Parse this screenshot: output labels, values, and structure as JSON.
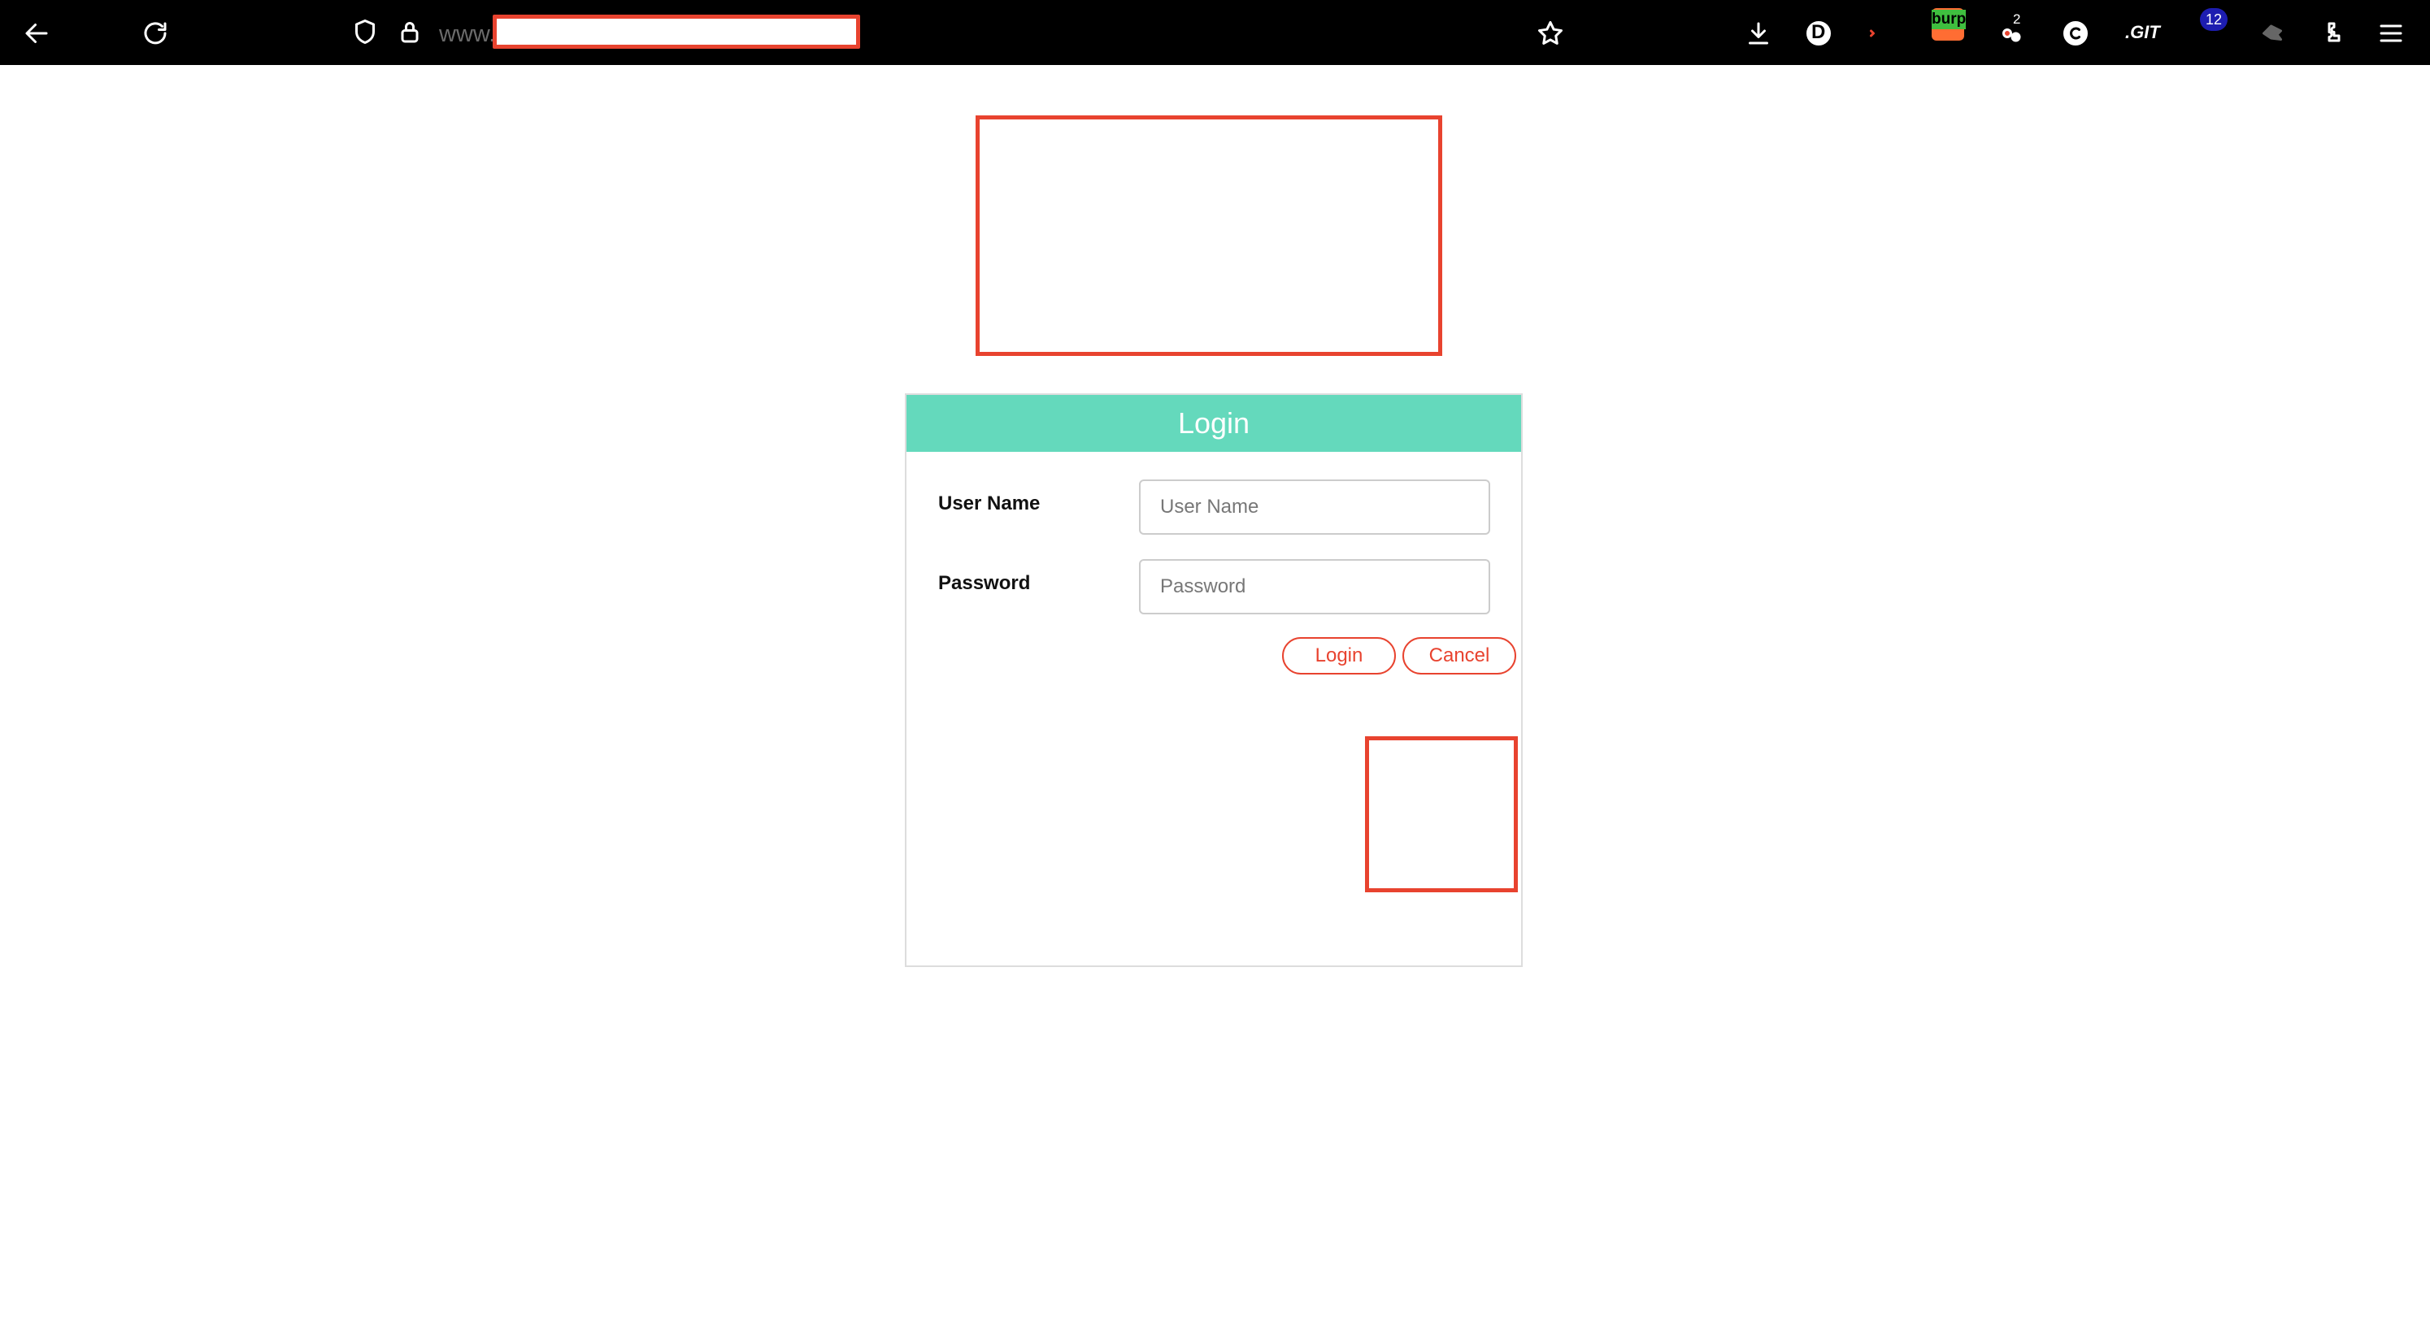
{
  "browser": {
    "url_prefix": "www.",
    "extensions": {
      "burp_label": "burp",
      "counter_badge": "2",
      "tab_count_badge": "12",
      "d_icon_letter": "D",
      "git_icon_text": ".GIT"
    },
    "icons": [
      "back-arrow-icon",
      "reload-icon",
      "shield-icon",
      "lock-icon",
      "star-icon",
      "download-icon",
      "puzzle-icon",
      "menu-icon"
    ]
  },
  "login": {
    "header": "Login",
    "username_label": "User Name",
    "username_placeholder": "User Name",
    "username_value": "",
    "password_label": "Password",
    "password_placeholder": "Password",
    "password_value": "",
    "login_button": "Login",
    "cancel_button": "Cancel"
  },
  "colors": {
    "accent": "#64d9bc",
    "button_red": "#e8432f",
    "toolbar_bg": "#000000"
  }
}
